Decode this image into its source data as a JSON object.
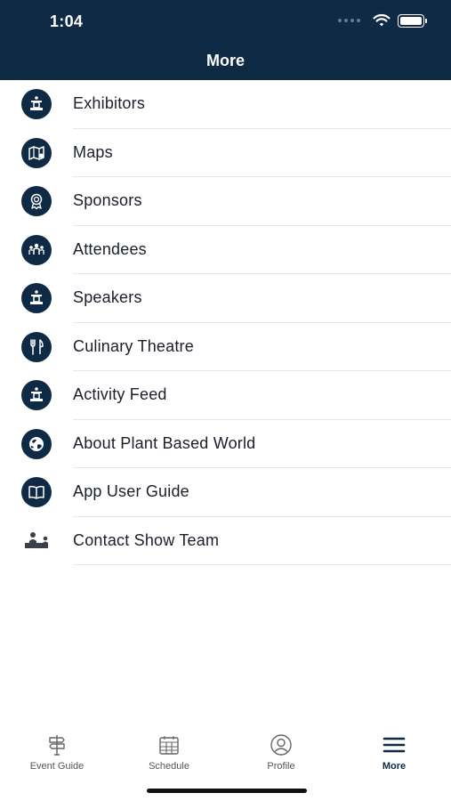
{
  "status_bar": {
    "time": "1:04"
  },
  "header": {
    "title": "More"
  },
  "menu": {
    "items": [
      {
        "label": "Exhibitors",
        "icon": "podium-icon"
      },
      {
        "label": "Maps",
        "icon": "map-icon"
      },
      {
        "label": "Sponsors",
        "icon": "award-ribbon-icon"
      },
      {
        "label": "Attendees",
        "icon": "people-icon"
      },
      {
        "label": "Speakers",
        "icon": "podium-icon"
      },
      {
        "label": "Culinary Theatre",
        "icon": "utensils-icon"
      },
      {
        "label": "Activity Feed",
        "icon": "podium-icon"
      },
      {
        "label": "About Plant Based World",
        "icon": "globe-icon"
      },
      {
        "label": "App User Guide",
        "icon": "book-icon"
      },
      {
        "label": "Contact Show Team",
        "icon": "help-desk-icon"
      }
    ]
  },
  "tabbar": {
    "tabs": [
      {
        "label": "Event Guide",
        "icon": "signpost-icon",
        "active": false
      },
      {
        "label": "Schedule",
        "icon": "calendar-icon",
        "active": false
      },
      {
        "label": "Profile",
        "icon": "profile-icon",
        "active": false
      },
      {
        "label": "More",
        "icon": "hamburger-icon",
        "active": true
      }
    ]
  },
  "colors": {
    "header_bg": "#0f2a44",
    "icon_bg": "#0f2a44",
    "divider": "#e6e6e6"
  }
}
